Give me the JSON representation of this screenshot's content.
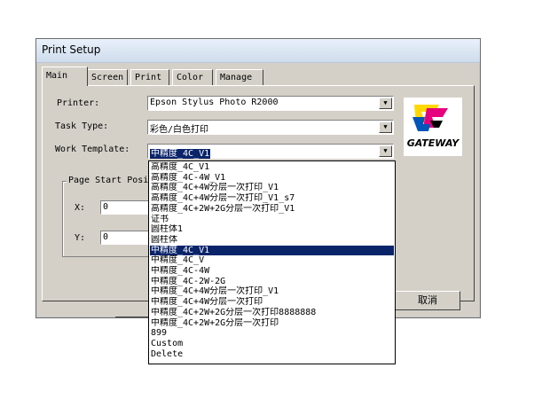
{
  "window": {
    "title": "Print Setup"
  },
  "tabs": [
    "Main",
    "Screen",
    "Print",
    "Color",
    "Manage"
  ],
  "form": {
    "printer_label": "Printer:",
    "printer_value": "Epson Stylus Photo R2000",
    "task_type_label": "Task Type:",
    "task_type_value": "彩色/白色打印",
    "work_template_label": "Work Template:",
    "work_template_value": "中精度_4C_V1"
  },
  "page_start": {
    "label": "Page Start Posi",
    "x_label": "X:",
    "x_value": "0",
    "y_label": "Y:",
    "y_value": "0"
  },
  "logo": {
    "text": "GATEWAY",
    "colors": [
      "#e6007e",
      "#ffd800",
      "#0055b8",
      "#000000"
    ]
  },
  "buttons": {
    "cancel": "取消"
  },
  "template_options": [
    "高精度_4C_V1",
    "高精度_4C-4W_V1",
    "高精度_4C+4W分层一次打印_V1",
    "高精度_4C+4W分层一次打印_V1_s7",
    "高精度_4C+2W+2G分层一次打印_V1",
    "证书",
    "圆柱体1",
    "圆柱体",
    "中精度_4C_V1",
    "中精度_4C_V",
    "中精度_4C-4W",
    "中精度_4C-2W-2G",
    "中精度_4C+4W分层一次打印_V1",
    "中精度_4C+4W分层一次打印",
    "中精度_4C+2W+2G分层一次打印8888888",
    "中精度_4C+2W+2G分层一次打印",
    "899",
    "Custom",
    "Delete"
  ],
  "selected_option_index": 8
}
